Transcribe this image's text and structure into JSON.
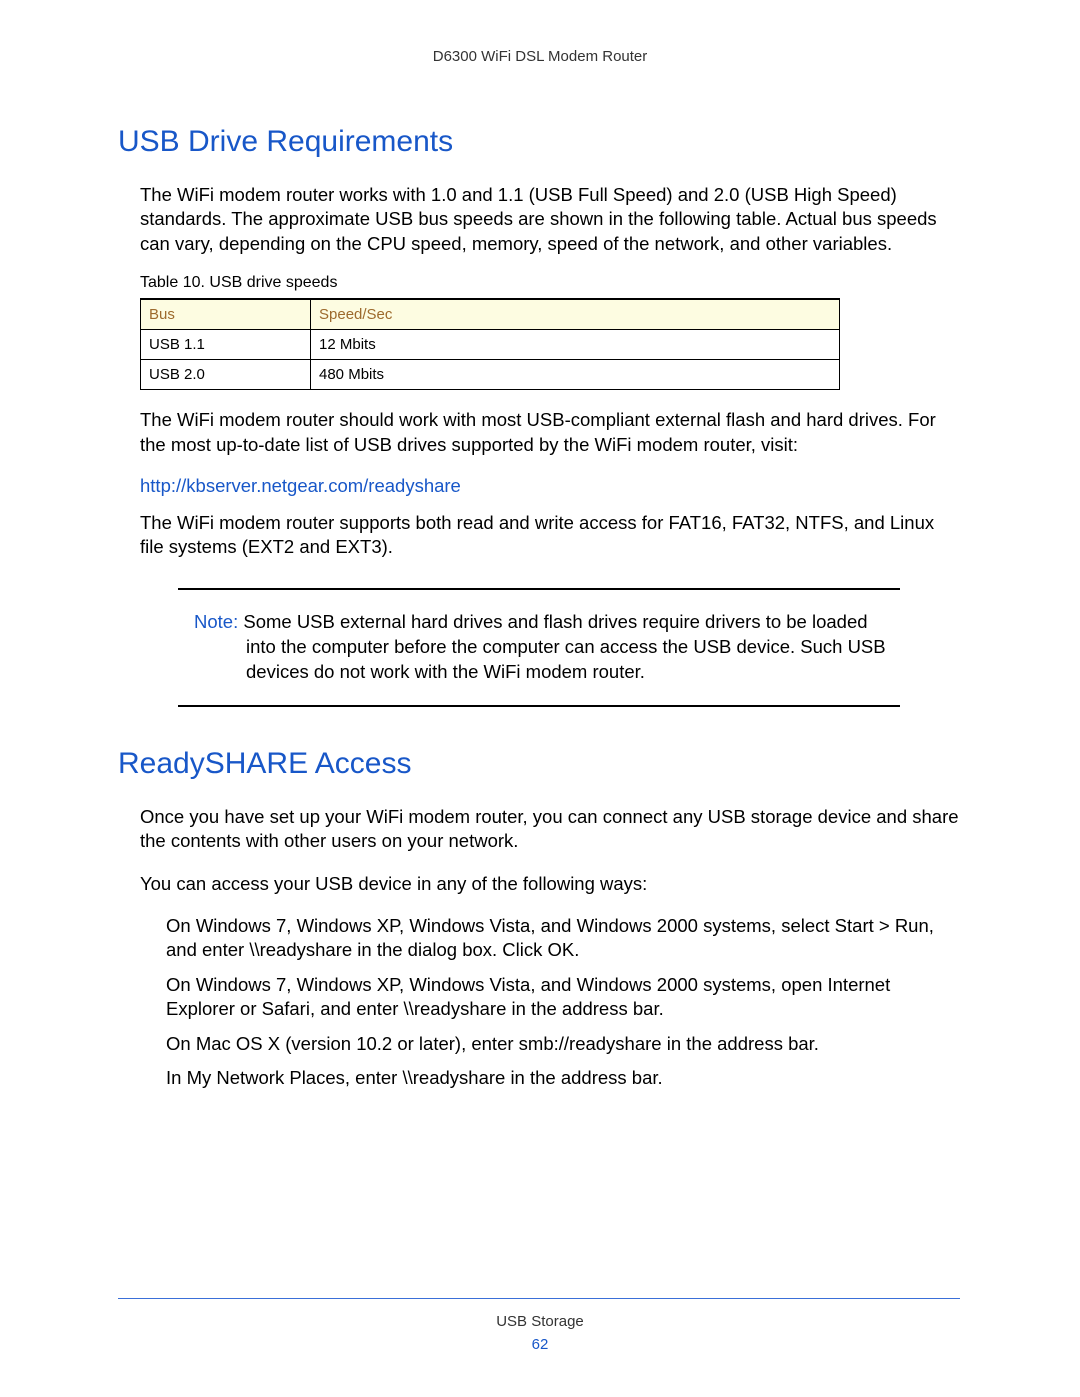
{
  "header": "D6300 WiFi DSL Modem Router",
  "section1": {
    "title": "USB Drive Requirements",
    "p1": "The WiFi modem router works with 1.0 and 1.1 (USB Full Speed) and 2.0 (USB High Speed) standards. The approximate USB bus speeds are shown in the following table. Actual bus speeds can vary, depending on the CPU speed, memory, speed of the network, and other variables.",
    "table_caption": "Table 10.  USB drive speeds",
    "table": {
      "headers": [
        "Bus",
        "Speed/Sec"
      ],
      "rows": [
        [
          "USB 1.1",
          "12 Mbits"
        ],
        [
          "USB 2.0",
          "480 Mbits"
        ]
      ]
    },
    "p2": "The WiFi modem router should work with most USB-compliant external flash and hard drives. For the most up-to-date list of USB drives supported by the WiFi modem router, visit:",
    "link": "http://kbserver.netgear.com/readyshare",
    "p3": "The WiFi modem router supports both read and write access for FAT16, FAT32, NTFS, and Linux file systems (EXT2 and EXT3).",
    "note_label": "Note:",
    "note_text": "Some USB external hard drives and flash drives require drivers to be loaded into the computer before the computer can access the USB device. Such USB devices do not work with the WiFi modem router."
  },
  "section2": {
    "title": "ReadySHARE Access",
    "p1": "Once you have set up your WiFi modem router, you can connect any USB storage device and share the contents with other users on your network.",
    "p2": "You can access your USB device in any of the following ways:",
    "items": [
      "On Windows 7, Windows XP, Windows Vista, and Windows 2000 systems, select Start > Run, and enter \\\\readyshare  in the dialog box. Click OK.",
      "On Windows 7, Windows XP, Windows Vista, and Windows 2000 systems, open Internet Explorer or Safari, and enter \\\\readyshare  in the address bar.",
      "On Mac OS X (version 10.2 or later), enter smb://readyshare in the address bar.",
      "In My Network Places, enter \\\\readyshare  in the address bar."
    ]
  },
  "footer": {
    "section": "USB Storage",
    "page": "62"
  }
}
